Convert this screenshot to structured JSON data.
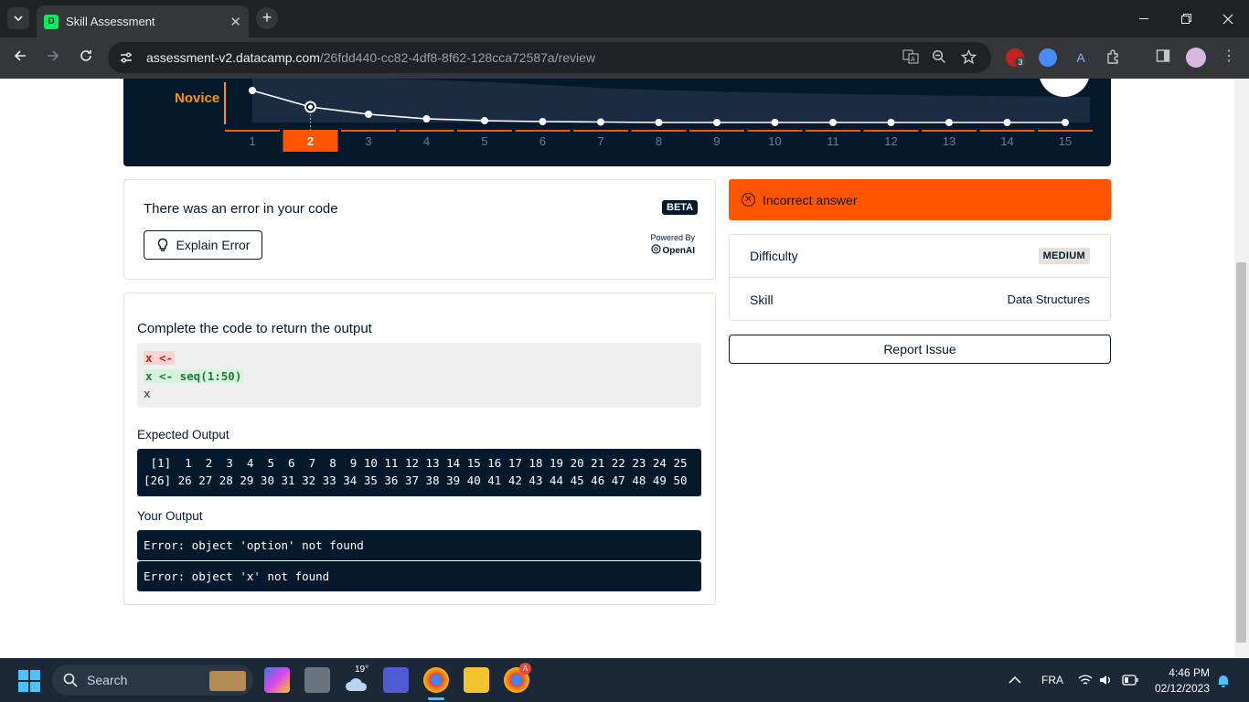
{
  "browser": {
    "tab_title": "Skill Assessment",
    "tab_close": "✕",
    "new_tab": "+",
    "url_host": "assessment-v2.datacamp.com",
    "url_path": "/26fdd440-cc82-4df8-8f62-128cca72587a/review",
    "extension_badge": "3"
  },
  "progress": {
    "level_label": "Novice",
    "questions": [
      "1",
      "2",
      "3",
      "4",
      "5",
      "6",
      "7",
      "8",
      "9",
      "10",
      "11",
      "12",
      "13",
      "14",
      "15"
    ],
    "current": "2"
  },
  "explain_card": {
    "heading": "There was an error in your code",
    "beta": "BETA",
    "button": "Explain Error",
    "powered_by": "Powered By",
    "provider": "OpenAI"
  },
  "question": {
    "prompt": "Complete the code to return the output",
    "code_removed": "x <- ",
    "code_added": "x <- seq(1:50)",
    "code_line3": "x",
    "expected_label": "Expected Output",
    "expected_lines": [
      " [1]  1  2  3  4  5  6  7  8  9 10 11 12 13 14 15 16 17 18 19 20 21 22 23 24 25",
      "[26] 26 27 28 29 30 31 32 33 34 35 36 37 38 39 40 41 42 43 44 45 46 47 48 49 50"
    ],
    "your_label": "Your Output",
    "your_lines": [
      "Error: object 'option' not found",
      "Error: object 'x' not found"
    ]
  },
  "result": {
    "status": "Incorrect answer",
    "difficulty_label": "Difficulty",
    "difficulty_value": "MEDIUM",
    "skill_label": "Skill",
    "skill_value": "Data Structures",
    "report_button": "Report Issue"
  },
  "taskbar": {
    "search": "Search",
    "weather": "19°",
    "lang": "FRA",
    "time": "4:46 PM",
    "date": "02/12/2023",
    "chrome_badge": "A"
  },
  "colors": {
    "navy": "#05192d",
    "orange": "#ff5400",
    "amber": "#ff9400",
    "green": "#03ef62"
  }
}
